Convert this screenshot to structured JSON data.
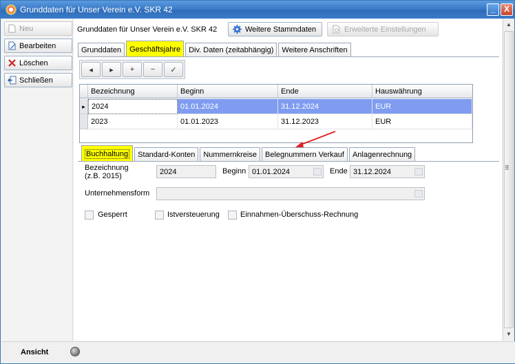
{
  "window": {
    "title": "Grunddaten für Unser Verein e.V. SKR 42",
    "minimize": "_",
    "maximize": "□",
    "close": "X"
  },
  "sidebar": {
    "new_label": "Neu",
    "edit_label": "Bearbeiten",
    "delete_label": "Löschen",
    "close_label": "Schließen"
  },
  "header": {
    "title": "Grunddaten für Unser Verein e.V. SKR 42",
    "more_master_data": "Weitere Stammdaten",
    "extended_settings": "Erweiterte Einstellungen"
  },
  "main_tabs": [
    "Grunddaten",
    "Geschäftsjahre",
    "Div. Daten (zeitabhängig)",
    "Weitere Anschriften"
  ],
  "navigator": {
    "prev": "◂",
    "next": "▸",
    "add": "+",
    "remove": "−",
    "confirm": "✓"
  },
  "grid": {
    "columns": [
      "Bezeichnung",
      "Beginn",
      "Ende",
      "Hauswährung"
    ],
    "rows": [
      [
        "2024",
        "01.01.2024",
        "31.12.2024",
        "EUR"
      ],
      [
        "2023",
        "01.01.2023",
        "31.12.2023",
        "EUR"
      ]
    ],
    "selected_indicator": "▸"
  },
  "sub_tabs": [
    "Buchhaltung",
    "Standard-Konten",
    "Nummernkreise",
    "Belegnummern Verkauf",
    "Anlagenrechnung"
  ],
  "form": {
    "bezeichnung_label_1": "Bezeichnung",
    "bezeichnung_label_2": "(z.B. 2015)",
    "bezeichnung_value": "2024",
    "beginn_label": "Beginn",
    "beginn_value": "01.01.2024",
    "ende_label": "Ende",
    "ende_value": "31.12.2024",
    "unternehmensform_label": "Unternehmensform",
    "unternehmensform_value": "",
    "gesperrt_label": "Gesperrt",
    "istversteuerung_label": "Istversteuerung",
    "euer_label": "Einnahmen-Überschuss-Rechnung"
  },
  "scrollbar": {
    "up": "▲",
    "down": "▼",
    "splitter": "⠿"
  },
  "status": {
    "label": "Ansicht"
  },
  "colors": {
    "selection": "#7f9cf0",
    "highlight": "#ffff00",
    "arrow": "#e02020",
    "title_bar": "#3b7bc8"
  }
}
